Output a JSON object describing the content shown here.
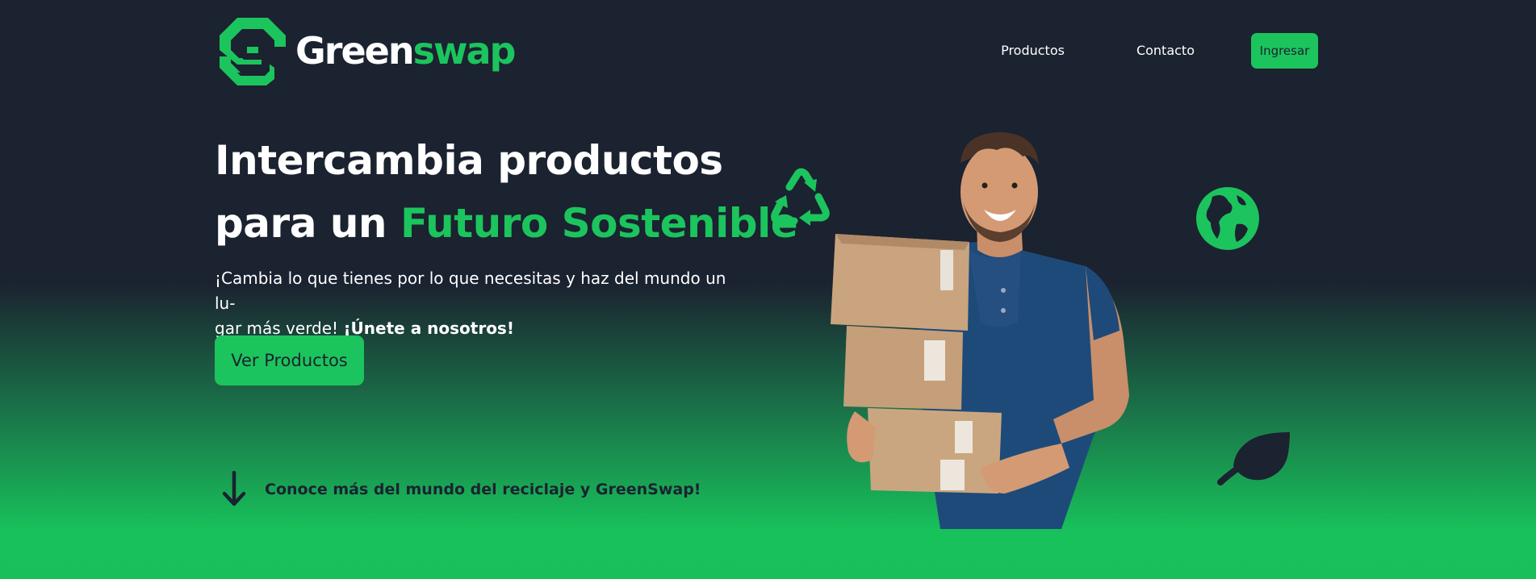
{
  "header": {
    "logo": {
      "icon": "greenswap-logo-mark",
      "text_white": "Green",
      "text_green": "swap"
    },
    "nav": [
      {
        "label": "Productos"
      },
      {
        "label": "Contacto"
      }
    ],
    "login_label": "Ingresar"
  },
  "hero": {
    "title_line1": "Intercambia productos",
    "title_line2_prefix": "para un ",
    "title_line2_accent": "Futuro Sostenible",
    "description_line1": "¡Cambia lo que tienes por lo que necesitas y haz del mundo un lu-",
    "description_line2": "gar más verde! ",
    "description_bold": "¡Únete a nosotros!",
    "cta_label": "Ver Productos",
    "learn_more": "Conoce más del mundo del reciclaje y GreenSwap!",
    "image_subject": "person-carrying-boxes"
  },
  "icons": [
    "recycle-icon",
    "globe-icon",
    "leaf-icon",
    "arrow-down-icon"
  ],
  "colors": {
    "background_dark": "#1b2230",
    "accent_green": "#1cc45d"
  }
}
